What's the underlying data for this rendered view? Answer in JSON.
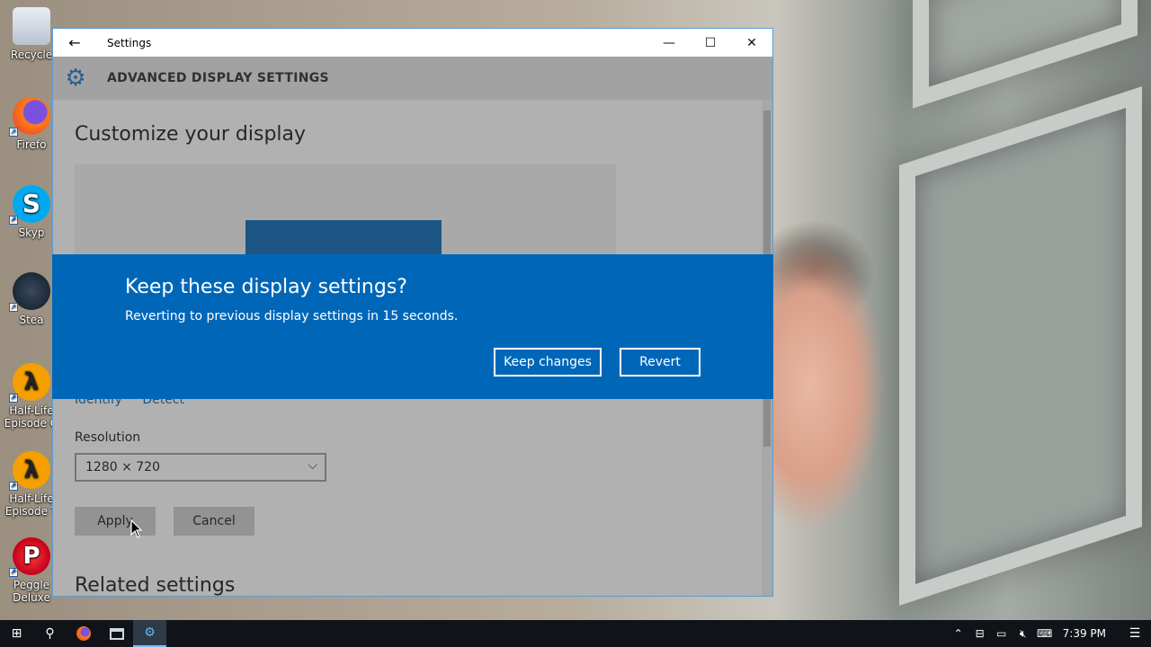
{
  "desktop": {
    "icons": [
      {
        "label": "Recycle",
        "icon": "recycle-bin-icon"
      },
      {
        "label": "Firefo",
        "icon": "firefox-icon"
      },
      {
        "label": "Skyp",
        "icon": "skype-icon"
      },
      {
        "label": "Stea",
        "icon": "steam-icon"
      },
      {
        "label": "Half-Life Episode O",
        "icon": "half-life-icon"
      },
      {
        "label": "Half-Life Episode T",
        "icon": "half-life-icon"
      },
      {
        "label": "Peggle Deluxe",
        "icon": "peggle-icon"
      }
    ]
  },
  "window": {
    "title": "Settings",
    "header_title": "ADVANCED DISPLAY SETTINGS",
    "page_title": "Customize your display",
    "links": {
      "identify": "Identify",
      "detect": "Detect"
    },
    "resolution_label": "Resolution",
    "resolution_value": "1280 × 720",
    "apply_label": "Apply",
    "cancel_label": "Cancel",
    "related_heading": "Related settings"
  },
  "dialog": {
    "title": "Keep these display settings?",
    "message": "Reverting to previous display settings in 15 seconds.",
    "keep_label": "Keep changes",
    "revert_label": "Revert"
  },
  "taskbar": {
    "clock": "7:39 PM"
  },
  "colors": {
    "accent": "#0067b8",
    "monitor": "#0063b1"
  }
}
